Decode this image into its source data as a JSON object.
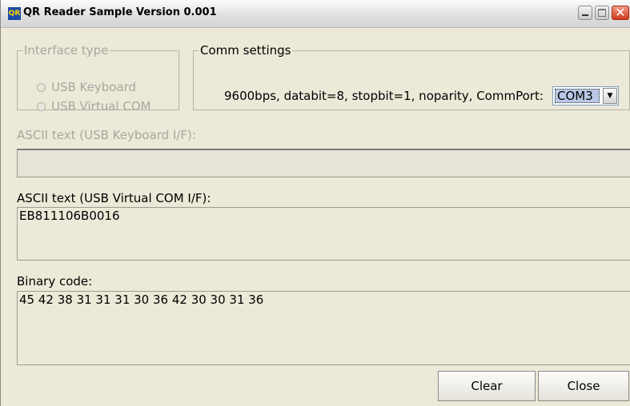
{
  "window": {
    "icon_text": "QR",
    "title": "QR Reader Sample Version 0.001"
  },
  "interface_group": {
    "legend": "Interface type",
    "options": [
      "USB Keyboard",
      "USB Virtual COM"
    ]
  },
  "comm_group": {
    "legend": "Comm settings",
    "settings_text": "9600bps, databit=8, stopbit=1, noparity, CommPort:",
    "port_selected": "COM3"
  },
  "keyboard_section": {
    "label": "ASCII text (USB Keyboard I/F):",
    "value": ""
  },
  "vcom_section": {
    "label": "ASCII text (USB Virtual COM I/F):",
    "value": "EB811106B0016"
  },
  "binary_section": {
    "label": "Binary code:",
    "value": "45 42 38 31 31 31 30 36 42 30 30 31 36"
  },
  "buttons": {
    "clear": "Clear",
    "close": "Close"
  }
}
